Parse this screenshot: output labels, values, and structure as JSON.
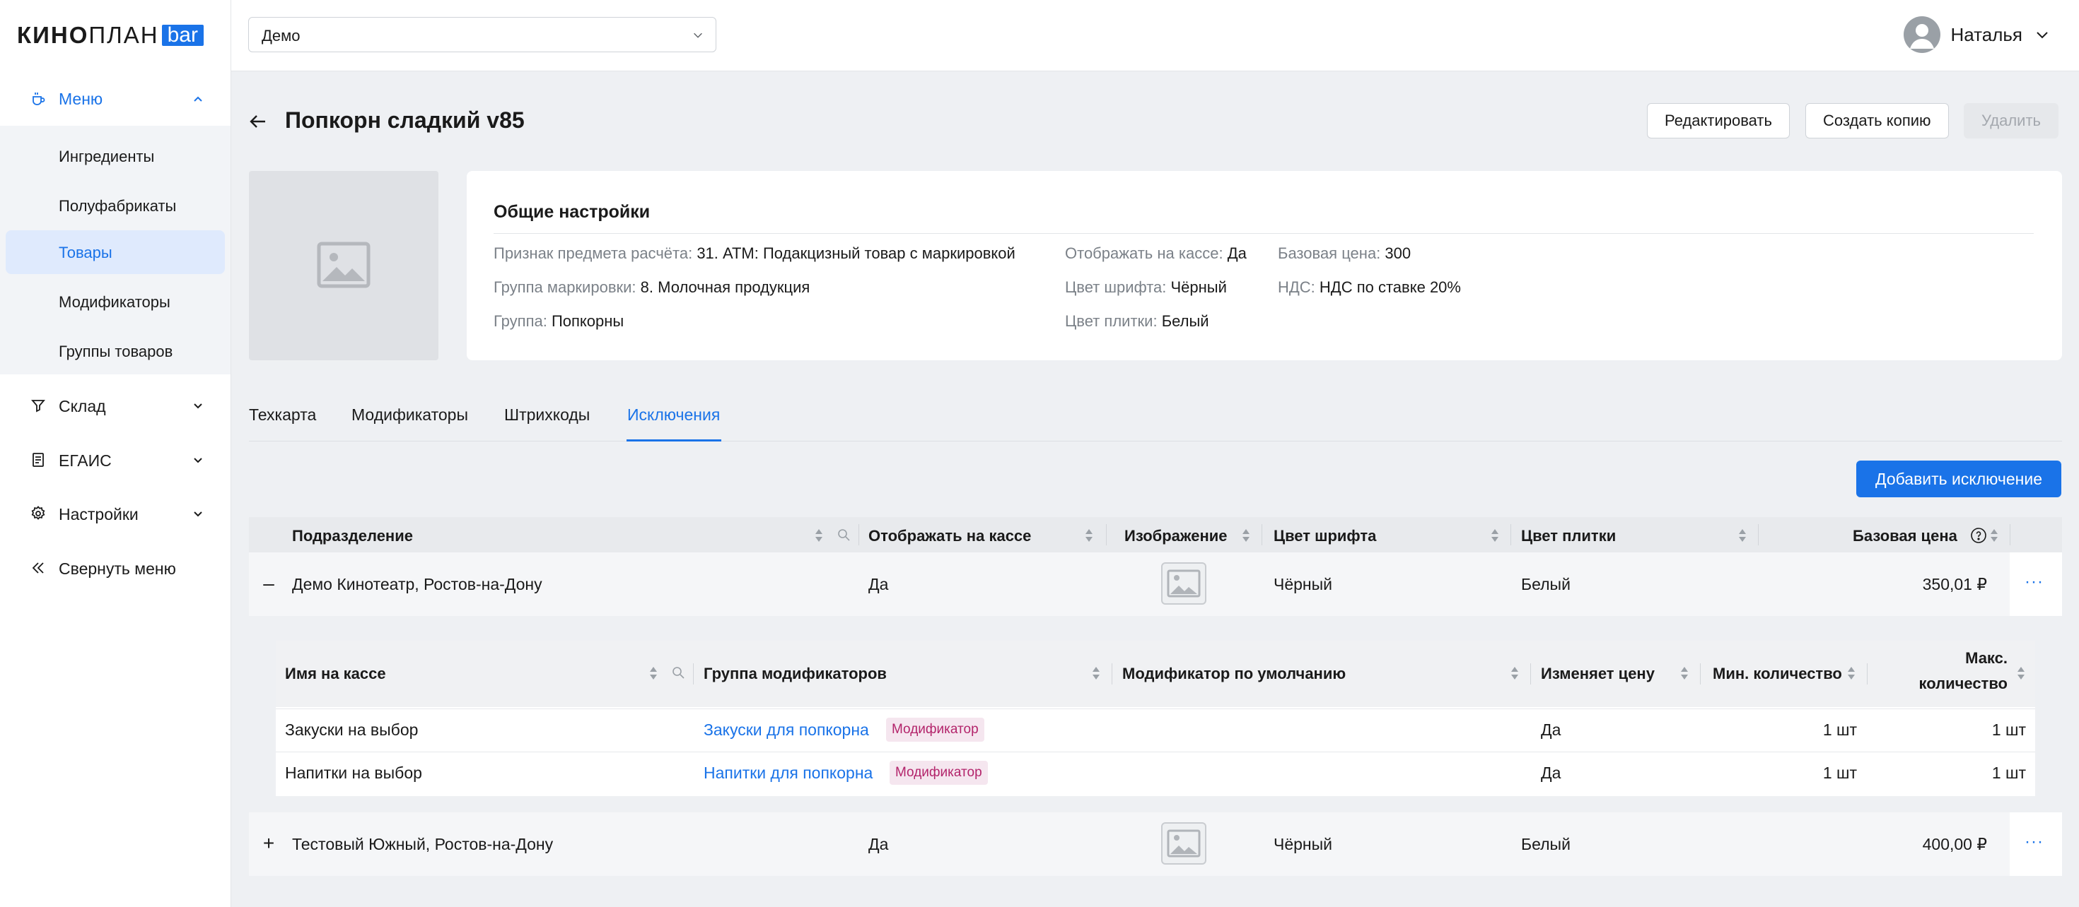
{
  "sidebar": {
    "logo": {
      "kino": "КИНО",
      "plan": "ПЛАН",
      "bar": "bar"
    },
    "menu": {
      "label": "Меню"
    },
    "submenu": [
      "Ингредиенты",
      "Полуфабрикаты",
      "Товары",
      "Модификаторы",
      "Группы товаров"
    ],
    "active_submenu": "Товары",
    "items": [
      {
        "label": "Склад"
      },
      {
        "label": "ЕГАИС"
      },
      {
        "label": "Настройки"
      },
      {
        "label": "Свернуть меню"
      }
    ]
  },
  "topbar": {
    "cinema_select": "Демо",
    "user_name": "Наталья"
  },
  "page": {
    "title": "Попкорн сладкий v85",
    "edit_label": "Редактировать",
    "copy_label": "Создать копию",
    "delete_label": "Удалить"
  },
  "general": {
    "title": "Общие настройки",
    "payment_attr_key": "Признак предмета расчёта:",
    "payment_attr_val": "31. АТМ: Подакцизный товар с маркировкой",
    "marking_group_key": "Группа маркировки:",
    "marking_group_val": "8. Молочная продукция",
    "group_key": "Группа:",
    "group_val": "Попкорны",
    "show_key": "Отображать на кассе:",
    "show_val": "Да",
    "font_color_key": "Цвет шрифта:",
    "font_color_val": "Чёрный",
    "tile_color_key": "Цвет плитки:",
    "tile_color_val": "Белый",
    "base_price_key": "Базовая цена:",
    "base_price_val": "300",
    "vat_key": "НДС:",
    "vat_val": "НДС по ставке 20%"
  },
  "tabs": [
    "Техкарта",
    "Модификаторы",
    "Штрихкоды",
    "Исключения"
  ],
  "active_tab": "Исключения",
  "add_exception_label": "Добавить исключение",
  "table": {
    "headers": [
      "Подразделение",
      "Отображать на кассе",
      "Изображение",
      "Цвет шрифта",
      "Цвет плитки",
      "Базовая цена"
    ],
    "rows": [
      {
        "toggle": "–",
        "division": "Демо Кинотеатр, Ростов-на-Дону",
        "show": "Да",
        "font_color": "Чёрный",
        "tile_color": "Белый",
        "price": "350,01 ₽",
        "more": "···"
      },
      {
        "toggle": "+",
        "division": "Тестовый Южный, Ростов-на-Дону",
        "show": "Да",
        "font_color": "Чёрный",
        "tile_color": "Белый",
        "price": "400,00 ₽",
        "more": "···"
      }
    ]
  },
  "nested": {
    "headers": [
      "Имя на кассе",
      "Группа модификаторов",
      "Модификатор по умолчанию",
      "Изменяет цену",
      "Мин. количество",
      "Макс.",
      "количество"
    ],
    "rows": [
      {
        "name": "Закуски на выбор",
        "group": "Закуски для попкорна",
        "badge": "Модификатор",
        "default": "",
        "changes_price": "Да",
        "min": "1 шт",
        "max": "1 шт"
      },
      {
        "name": "Напитки на выбор",
        "group": "Напитки для попкорна",
        "badge": "Модификатор",
        "default": "",
        "changes_price": "Да",
        "min": "1 шт",
        "max": "1 шт"
      }
    ]
  },
  "colors": {
    "accent": "#1a73e8",
    "badge_bg": "#f5e6ef",
    "badge_text": "#b3246b"
  }
}
